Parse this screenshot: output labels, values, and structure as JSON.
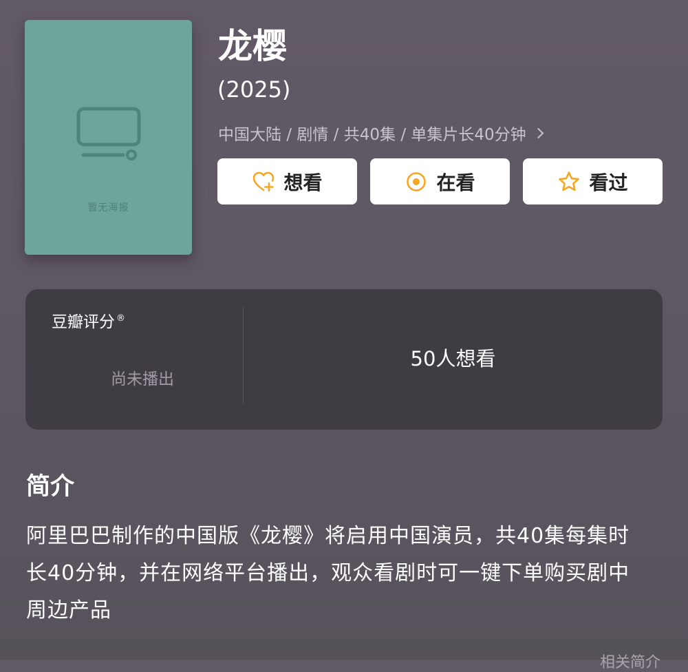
{
  "poster": {
    "placeholder_label": "暂无海报",
    "icon": "tv-icon",
    "color": "#6da49b"
  },
  "subject": {
    "title": "龙樱",
    "year": "(2025)",
    "meta": "中国大陆 / 剧情 / 共40集 / 单集片长40分钟"
  },
  "actions": [
    {
      "label": "想看",
      "icon": "heart-plus-icon"
    },
    {
      "label": "在看",
      "icon": "watching-circle-icon"
    },
    {
      "label": "看过",
      "icon": "star-icon"
    }
  ],
  "rating": {
    "title": "豆瓣评分",
    "mark": "®",
    "status": "尚未播出",
    "want_count": "50人想看"
  },
  "intro": {
    "heading": "简介",
    "body": "阿里巴巴制作的中国版《龙樱》将启用中国演员，共40集每集时长40分钟，并在网络平台播出，观众看剧时可一键下单购买剧中周边产品",
    "more_label": "相关简介"
  },
  "colors": {
    "accent": "#f5a623",
    "panel": "#3f3c43",
    "background": "#5f5763"
  }
}
